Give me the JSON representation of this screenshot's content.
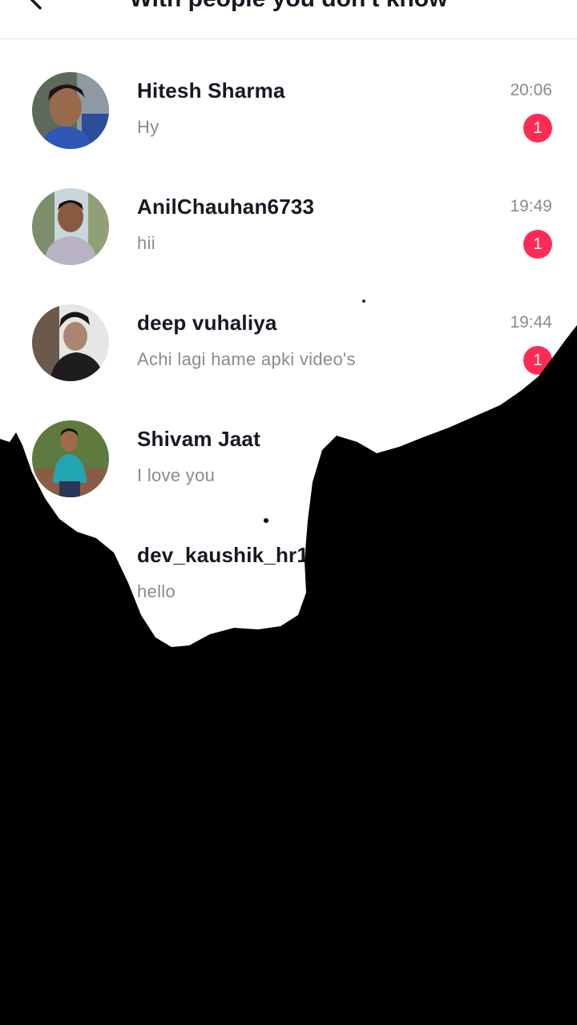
{
  "header": {
    "title": "With people you don't know",
    "back_icon": "chevron-left-icon"
  },
  "conversations": [
    {
      "name": "Hitesh Sharma",
      "time": "20:06",
      "preview": "Hy",
      "unread": "1"
    },
    {
      "name": "AnilChauhan6733",
      "time": "19:49",
      "preview": "hii",
      "unread": "1"
    },
    {
      "name": "deep vuhaliya",
      "time": "19:44",
      "preview": "Achi lagi hame apki video's",
      "unread": "1"
    },
    {
      "name": "Shivam Jaat",
      "time": "",
      "preview": "I love you",
      "unread": ""
    },
    {
      "name": "dev_kaushik_hr1",
      "time": "",
      "preview": "hello",
      "unread": ""
    }
  ],
  "colors": {
    "badge": "#fe2c55",
    "name_text": "#161823",
    "secondary_text": "#8a8b91",
    "overlay": "#000000"
  }
}
